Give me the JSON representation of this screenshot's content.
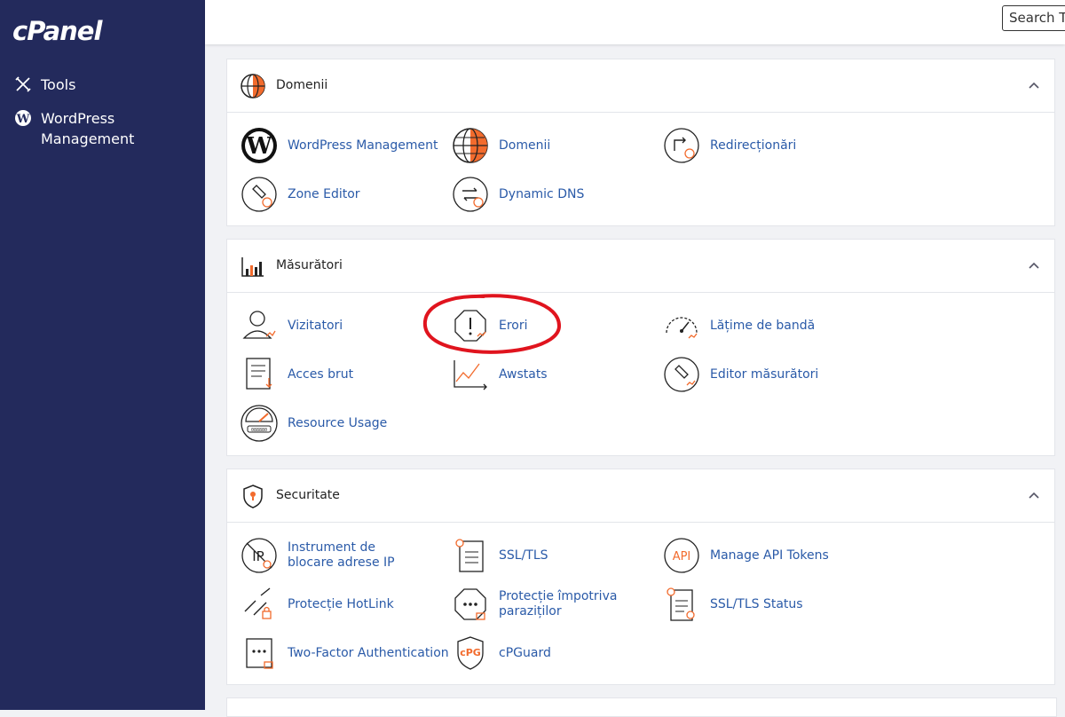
{
  "sidebar": {
    "logo": "cPanel",
    "items": [
      {
        "label": "Tools",
        "icon": "tools-icon"
      },
      {
        "label": "WordPress Management",
        "icon": "wordpress-icon"
      }
    ]
  },
  "header": {
    "search_value": "Search Tools"
  },
  "sections": [
    {
      "title": "Domenii",
      "icon": "globe-icon",
      "items": [
        {
          "label": "WordPress Management",
          "icon": "wordpress-icon"
        },
        {
          "label": "Domenii",
          "icon": "globe-icon"
        },
        {
          "label": "Redirecționări",
          "icon": "redirect-icon"
        },
        {
          "label": "Zone Editor",
          "icon": "zone-editor-icon"
        },
        {
          "label": "Dynamic DNS",
          "icon": "dynamic-dns-icon"
        }
      ]
    },
    {
      "title": "Măsurători",
      "icon": "bar-chart-icon",
      "items": [
        {
          "label": "Vizitatori",
          "icon": "visitors-icon"
        },
        {
          "label": "Erori",
          "icon": "errors-icon"
        },
        {
          "label": "Lățime de bandă",
          "icon": "bandwidth-icon"
        },
        {
          "label": "Acces brut",
          "icon": "raw-access-icon"
        },
        {
          "label": "Awstats",
          "icon": "awstats-icon"
        },
        {
          "label": "Editor măsurători",
          "icon": "metrics-editor-icon"
        },
        {
          "label": "Resource Usage",
          "icon": "resource-usage-icon"
        }
      ]
    },
    {
      "title": "Securitate",
      "icon": "shield-icon",
      "items": [
        {
          "label": "Instrument de blocare adrese IP",
          "icon": "ip-blocker-icon"
        },
        {
          "label": "SSL/TLS",
          "icon": "ssl-icon"
        },
        {
          "label": "Manage API Tokens",
          "icon": "api-icon"
        },
        {
          "label": "Protecție HotLink",
          "icon": "hotlink-icon"
        },
        {
          "label": "Protecție împotriva paraziților",
          "icon": "leech-protect-icon"
        },
        {
          "label": "SSL/TLS Status",
          "icon": "ssl-status-icon"
        },
        {
          "label": "Two-Factor Authentication",
          "icon": "two-factor-icon"
        },
        {
          "label": "cPGuard",
          "icon": "cpguard-icon"
        }
      ]
    }
  ],
  "colors": {
    "sidebar": "#232a5c",
    "link": "#2a5aa8",
    "accent": "#f26b2d",
    "annotation": "#e0141e"
  }
}
